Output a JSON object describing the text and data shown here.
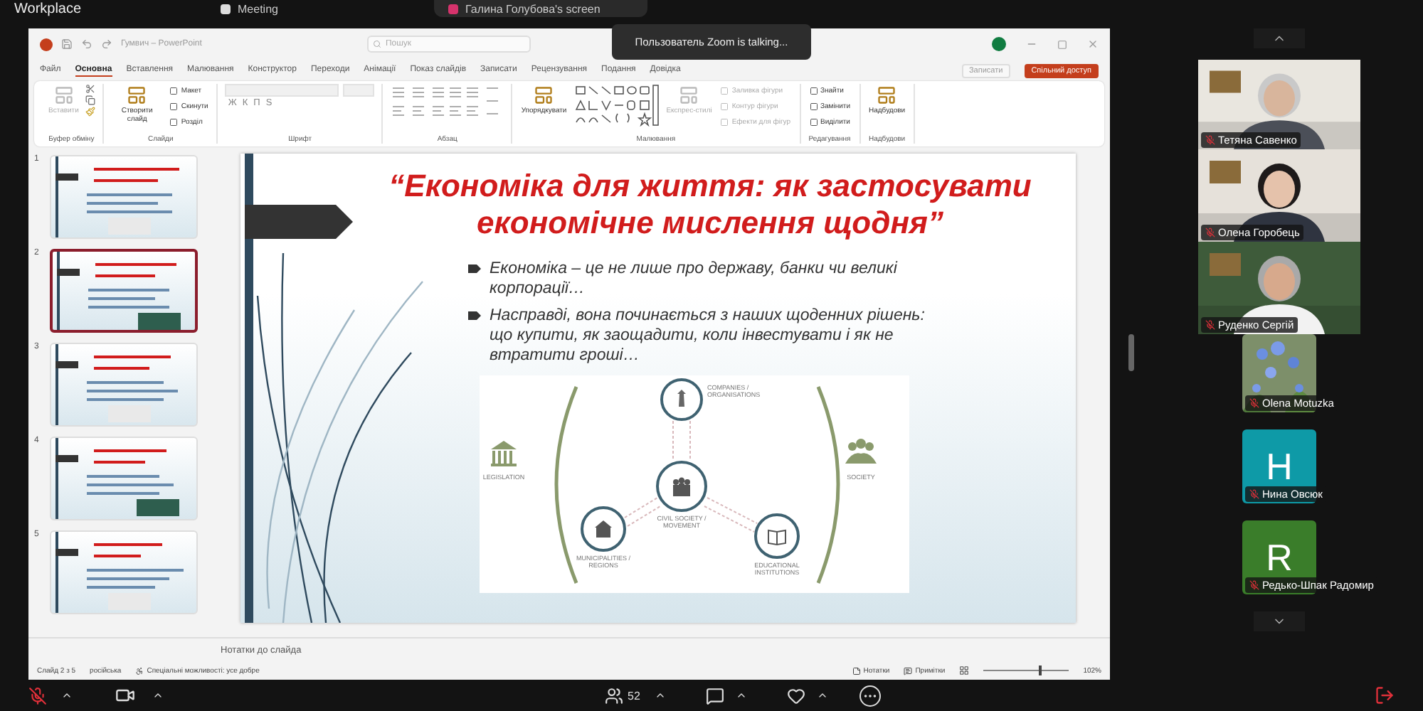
{
  "zoom_top": {
    "app": "Workplace",
    "tabs": [
      {
        "label": "Meeting",
        "selected": false
      },
      {
        "label": "Галина Голубова's screen",
        "selected": true
      }
    ]
  },
  "toast": "Пользователь Zoom is talking...",
  "powerpoint": {
    "title": "Гумвич – PowerPoint",
    "search": {
      "placeholder": "Пошук"
    },
    "menu_tabs": [
      {
        "label": "Файл",
        "selected": false
      },
      {
        "label": "Основна",
        "selected": true
      },
      {
        "label": "Вставлення",
        "selected": false
      },
      {
        "label": "Малювання",
        "selected": false
      },
      {
        "label": "Конструктор",
        "selected": false
      },
      {
        "label": "Переходи",
        "selected": false
      },
      {
        "label": "Анімації",
        "selected": false
      },
      {
        "label": "Показ слайдів",
        "selected": false
      },
      {
        "label": "Записати",
        "selected": false
      },
      {
        "label": "Рецензування",
        "selected": false
      },
      {
        "label": "Подання",
        "selected": false
      },
      {
        "label": "Довідка",
        "selected": false
      }
    ],
    "record_button": "Записати",
    "share_button": "Спільний доступ",
    "ribbon": [
      {
        "label": "Буфер обміну",
        "kind": "clipboard",
        "items": [
          {
            "kind": "large",
            "label": "Вставити",
            "disabled": true
          }
        ]
      },
      {
        "label": "Слайди",
        "kind": "plain",
        "items": [
          {
            "kind": "large",
            "label": "Створити слайд",
            "disabled": false
          },
          {
            "kind": "small",
            "label": "Макет",
            "disabled": false
          },
          {
            "kind": "small",
            "label": "Скинути",
            "disabled": false
          },
          {
            "kind": "small",
            "label": "Розділ",
            "disabled": false
          }
        ]
      },
      {
        "label": "Шрифт",
        "kind": "font",
        "glyphs": [
          "Ж",
          "К",
          "П",
          "S"
        ]
      },
      {
        "label": "Абзац",
        "kind": "paragraph"
      },
      {
        "label": "Малювання",
        "kind": "shapes",
        "items": [
          {
            "kind": "large",
            "label": "Упорядкувати",
            "disabled": false
          },
          {
            "kind": "large",
            "label": "Експрес-стилі",
            "disabled": true
          },
          {
            "kind": "small",
            "label": "Заливка фігури",
            "disabled": true
          },
          {
            "kind": "small",
            "label": "Контур фігури",
            "disabled": true
          },
          {
            "kind": "small",
            "label": "Ефекти для фігур",
            "disabled": true
          }
        ]
      },
      {
        "label": "Редагування",
        "kind": "plain",
        "items": [
          {
            "kind": "small",
            "label": "Знайти",
            "disabled": false
          },
          {
            "kind": "small",
            "label": "Замінити",
            "disabled": false
          },
          {
            "kind": "small",
            "label": "Виділити",
            "disabled": false
          }
        ]
      },
      {
        "label": "Надбудови",
        "kind": "plain",
        "items": [
          {
            "kind": "large",
            "label": "Надбудови",
            "disabled": false
          }
        ]
      }
    ],
    "slides": [
      {
        "number": "1",
        "selected": false
      },
      {
        "number": "2",
        "selected": true
      },
      {
        "number": "3",
        "selected": false
      },
      {
        "number": "4",
        "selected": false
      },
      {
        "number": "5",
        "selected": false
      }
    ],
    "slide": {
      "title": "“Економіка для життя: як застосувати економічне мислення щодня”",
      "bullets": [
        "Економіка – це не лише про державу, банки чи великі корпорації…",
        "Насправді, вона починається з наших щоденних рішень: що купити, як заощадити, коли інвестувати і як не втратити гроші…"
      ],
      "diagram": [
        {
          "kind": "companies",
          "label": "COMPANIES / ORGANISATIONS"
        },
        {
          "kind": "civil",
          "label": "CIVIL SOCIETY / MOVEMENT"
        },
        {
          "kind": "municipal",
          "label": "MUNICIPALITIES / REGIONS"
        },
        {
          "kind": "education",
          "label": "EDUCATIONAL INSTITUTIONS"
        },
        {
          "kind": "legislation",
          "label": "LEGISLATION"
        },
        {
          "kind": "society",
          "label": "SOCIETY"
        }
      ]
    },
    "notes": "Нотатки до слайда",
    "status": {
      "slide": "Слайд 2 з 5",
      "language": "російська",
      "accessibility": "Спеціальні можливості: усе добре",
      "notes_button": "Нотатки",
      "comments_button": "Примітки",
      "zoom": "102%",
      "zoom_slider": {
        "level": 0.65
      }
    }
  },
  "participants": [
    {
      "name": "Тетяна Савенко",
      "kind": "video",
      "muted": true
    },
    {
      "name": "Олена Горобець",
      "kind": "video",
      "muted": true
    },
    {
      "name": "Руденко Сергій",
      "kind": "video",
      "muted": true
    },
    {
      "name": "Olena Motuzka",
      "muted": true
    },
    {
      "name": "Нина Овсюк",
      "kind": "avatar",
      "initial": "H",
      "color": "#0e9aa7",
      "muted": true
    },
    {
      "name": "Редько-Шпак Радомир",
      "kind": "avatar",
      "initial": "R",
      "color": "#3a7d2a",
      "muted": true
    }
  ],
  "toolbar": {
    "participants_count": "52",
    "mic_muted": true
  }
}
